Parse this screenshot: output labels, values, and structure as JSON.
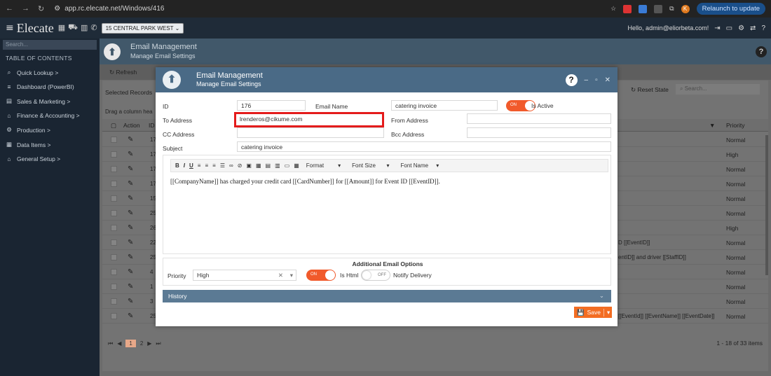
{
  "browser": {
    "url": "app.rc.elecate.net/Windows/416",
    "relaunch_label": "Relaunch to update",
    "profile_initial": "K"
  },
  "app": {
    "logo": "Elecate",
    "location": "15 CENTRAL PARK WEST",
    "hello": "Hello, admin@eliorbeta.com!"
  },
  "sidebar": {
    "search_placeholder": "Search...",
    "toc": "TABLE OF CONTENTS",
    "items": [
      {
        "label": "Quick Lookup  >",
        "icon": "search-icon"
      },
      {
        "label": "Dashboard (PowerBI)",
        "icon": "list-icon"
      },
      {
        "label": "Sales & Marketing  >",
        "icon": "store-icon"
      },
      {
        "label": "Finance & Accounting  >",
        "icon": "bank-icon"
      },
      {
        "label": "Production  >",
        "icon": "gear-icon"
      },
      {
        "label": "Data Items  >",
        "icon": "table-icon"
      },
      {
        "label": "General Setup  >",
        "icon": "home-icon"
      }
    ]
  },
  "page": {
    "title": "Email Management",
    "subtitle": "Manage Email Settings",
    "refresh_label": "Refresh",
    "selected_records": "Selected Records",
    "drag_column": "Drag a column hea",
    "reset_state": "Reset State",
    "search_placeholder": "Search...",
    "columns": {
      "action": "Action",
      "id": "ID",
      "priority": "Priority"
    },
    "rows": [
      {
        "id": "17",
        "extra": "",
        "priority": "Normal"
      },
      {
        "id": "17",
        "extra": "",
        "priority": "High"
      },
      {
        "id": "17",
        "extra": "",
        "priority": "Normal"
      },
      {
        "id": "17",
        "extra": "",
        "priority": "Normal"
      },
      {
        "id": "15",
        "extra": "",
        "priority": "Normal"
      },
      {
        "id": "25",
        "extra": "",
        "priority": "Normal"
      },
      {
        "id": "26",
        "extra": "",
        "priority": "High"
      },
      {
        "id": "22",
        "extra": "D [[EventID]]",
        "priority": "Normal"
      },
      {
        "id": "25",
        "extra": "entID]] and driver [[StaffID]]",
        "priority": "Normal"
      },
      {
        "id": "4",
        "extra": "",
        "priority": "Normal"
      },
      {
        "id": "1",
        "extra": "",
        "priority": "Normal"
      },
      {
        "id": "3",
        "extra": "",
        "priority": "Normal"
      },
      {
        "id": "25",
        "extra": "[[EventId]] [[EventName]] [[EventDate]]",
        "priority": "Normal"
      }
    ],
    "pager": {
      "page1": "1",
      "page2": "2"
    },
    "items_count": "1 - 18 of 33 items"
  },
  "modal": {
    "title": "Email Management",
    "subtitle": "Manage Email Settings",
    "labels": {
      "id": "ID",
      "email_name": "Email Name",
      "is_active": "Is Active",
      "to_address": "To Address",
      "from_address": "From Address",
      "cc_address": "CC Address",
      "bcc_address": "Bcc Address",
      "subject": "Subject"
    },
    "values": {
      "id": "176",
      "email_name": "catering invoice",
      "to_address": "lrenderos@cikume.com",
      "from_address": "",
      "cc_address": "",
      "bcc_address": "",
      "subject": "catering invoice"
    },
    "toggle_on": "ON",
    "toggle_off": "OFF",
    "editor": {
      "format": "Format",
      "font_size": "Font Size",
      "font_name": "Font Name",
      "body": "[[CompanyName]] has charged your credit card [[CardNumber]] for [[Amount]] for Event ID [[EventID]]."
    },
    "additional": {
      "title": "Additional Email Options",
      "priority_label": "Priority",
      "priority_value": "High",
      "is_html": "Is Html",
      "notify_delivery": "Notify Delivery"
    },
    "history": "History",
    "save": "Save"
  }
}
